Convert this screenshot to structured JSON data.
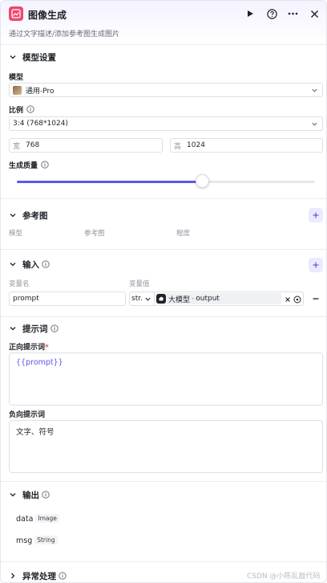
{
  "header": {
    "title": "图像生成",
    "subtitle": "通过文字描述/添加参考图生成图片"
  },
  "model_settings": {
    "title": "模型设置",
    "model_label": "模型",
    "model_value": "通用-Pro",
    "ratio_label": "比例",
    "ratio_value": "3:4 (768*1024)",
    "width_prefix": "宽",
    "width_value": "768",
    "height_prefix": "高",
    "height_value": "1024",
    "quality_label": "生成质量",
    "quality_fraction": 0.62
  },
  "reference": {
    "title": "参考图",
    "columns": [
      "模型",
      "参考图",
      "程度"
    ]
  },
  "input": {
    "title": "输入",
    "col_name": "变量名",
    "col_value": "变量值",
    "var_name": "prompt",
    "type": "str.",
    "source_node": "大模型",
    "separator": "-",
    "source_field": "output"
  },
  "prompt": {
    "title": "提示词",
    "positive_label": "正向提示词",
    "required_mark": "*",
    "positive_value": "{{prompt}}",
    "negative_label": "负向提示词",
    "negative_value": "文字、符号"
  },
  "output": {
    "title": "输出",
    "items": [
      {
        "name": "data",
        "type": "Image"
      },
      {
        "name": "msg",
        "type": "String"
      }
    ]
  },
  "error": {
    "title": "异常处理"
  },
  "watermark": "CSDN @小陈乱敲代码",
  "colors": {
    "accent": "#5a58e6",
    "app_icon": "#f0476a",
    "border": "#dee0e3"
  }
}
